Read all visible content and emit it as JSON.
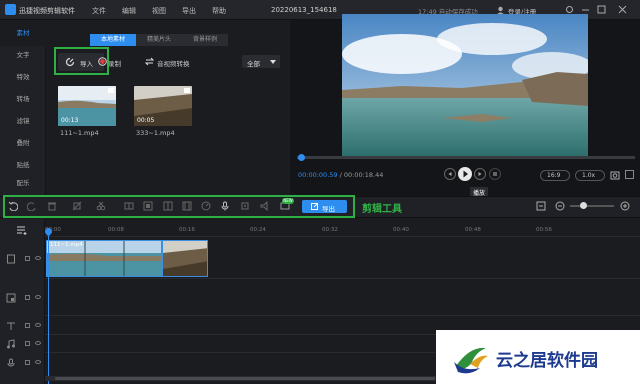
{
  "app": {
    "name": "迅捷视频剪辑软件",
    "project_title": "20220613_154618",
    "autosave": "17:49 自动保存成功",
    "login": "登录/注册"
  },
  "menu": [
    "文件",
    "编辑",
    "视图",
    "导出",
    "帮助"
  ],
  "sidebar": {
    "items": [
      {
        "label": "素材",
        "active": true
      },
      {
        "label": "文字"
      },
      {
        "label": "特效"
      },
      {
        "label": "转场"
      },
      {
        "label": "滤镜"
      },
      {
        "label": "叠附"
      },
      {
        "label": "贴纸"
      },
      {
        "label": "配乐"
      }
    ]
  },
  "media": {
    "tabs": [
      {
        "label": "本地素材",
        "active": true
      },
      {
        "label": "精美片头"
      },
      {
        "label": "背景样例"
      }
    ],
    "import_label": "导入",
    "record_label": "录制",
    "convert_label": "音视频转换",
    "filter_value": "全部",
    "items": [
      {
        "duration": "00:13",
        "name": "111~1.mp4"
      },
      {
        "duration": "00:05",
        "name": "333~1.mp4"
      }
    ]
  },
  "player": {
    "time_current": "00:00:00.59",
    "time_total": "/ 00:00:18.44",
    "tooltip": "播放",
    "aspect": "16:9",
    "speed": "1.0x"
  },
  "toolbar": {
    "export_label": "导出",
    "new_badge": "NEW",
    "caption": "剪辑工具"
  },
  "timeline": {
    "ruler": [
      "00:00",
      "00:08",
      "00:16",
      "00:24",
      "00:32",
      "00:40",
      "00:48",
      "00:56"
    ],
    "clips": [
      {
        "label": "111~1.mp4"
      },
      {
        "label": ""
      }
    ]
  },
  "watermark": {
    "text": "云之居软件园"
  },
  "colors": {
    "accent": "#2e8ef0",
    "highlight": "#2fb045"
  }
}
